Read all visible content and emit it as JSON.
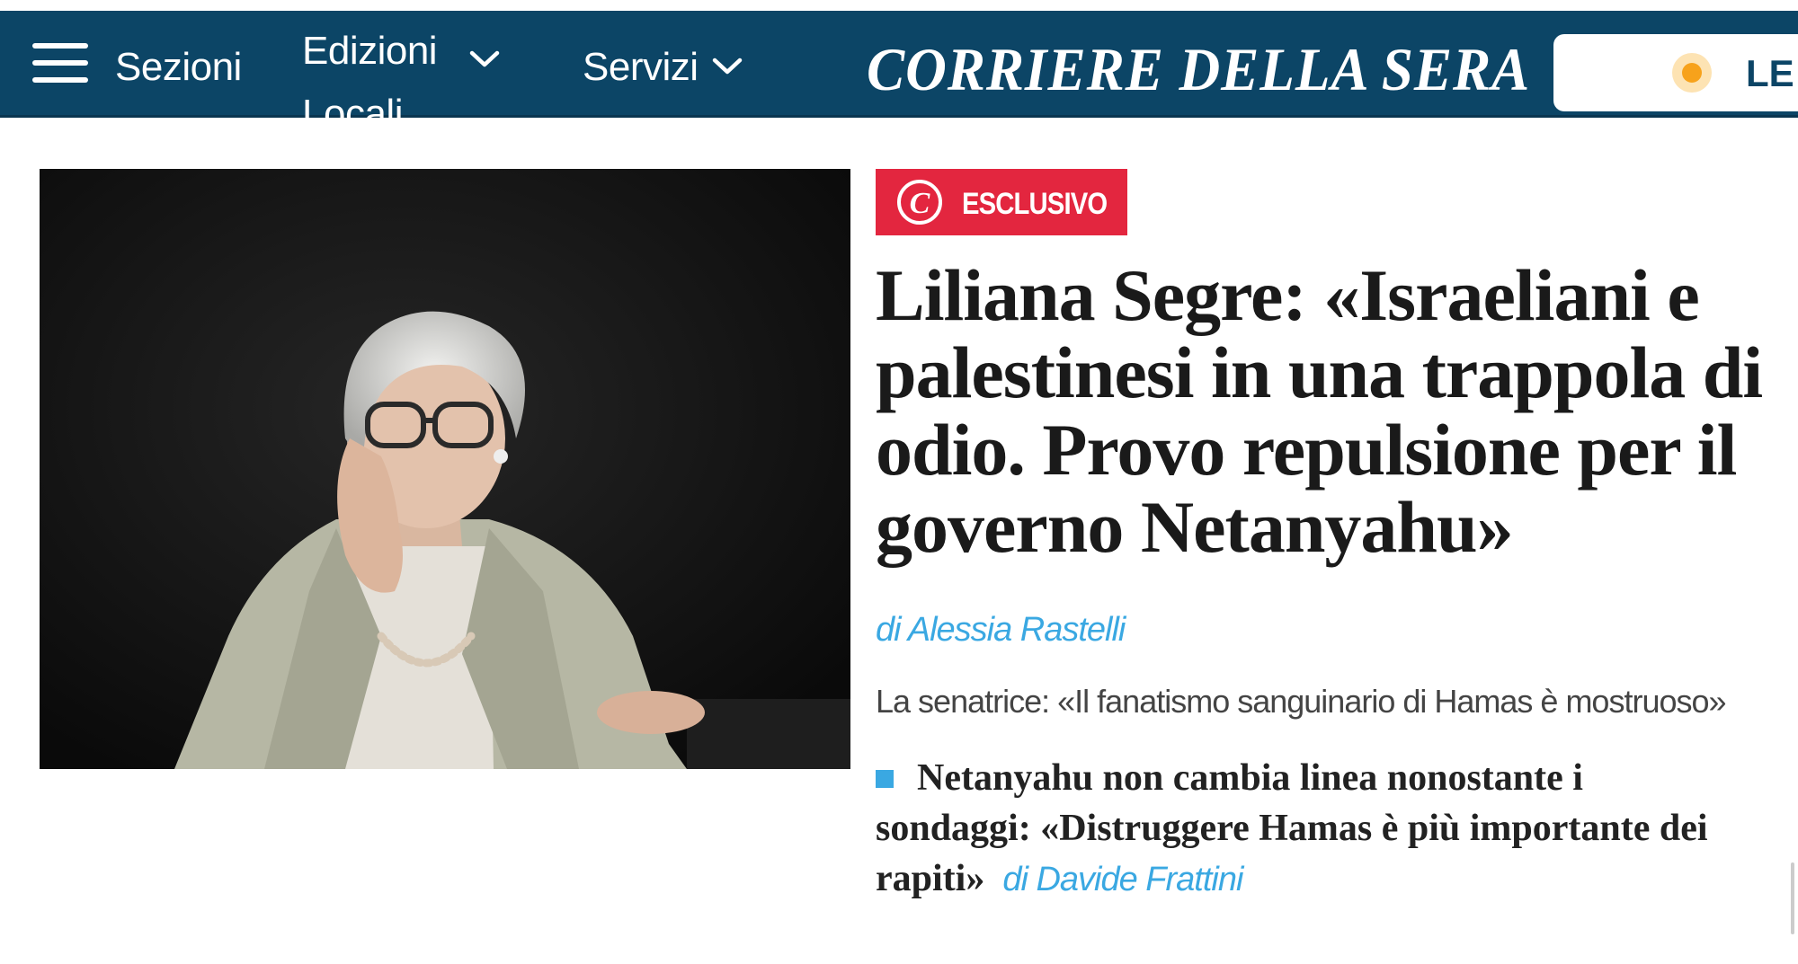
{
  "nav": {
    "sections_label": "Sezioni",
    "editions_label": "Edizioni Locali",
    "services_label": "Servizi",
    "logo_text": "CORRIERE DELLA SERA",
    "right_pill_label": "LE T",
    "brand_color": "#0c4566",
    "live_dot_color": "#f7a21b"
  },
  "article": {
    "badge_icon": "corriere-c-logo",
    "badge_label": "ESCLUSIVO",
    "badge_color": "#e3263f",
    "headline": "Liliana Segre: «Israeliani e palestinesi in una trappola di odio. Provo repulsione per il governo Netanyahu»",
    "byline": "di Alessia Rastelli",
    "subtitle": "La senatrice: «Il fanatismo sanguinario di Hamas è mostruoso»",
    "link_color": "#3aa8e2"
  },
  "related": {
    "text": "Netanyahu non cambia linea nonostante i sondaggi: «Distruggere Hamas è più importante dei rapiti»",
    "author": "di Davide Frattini"
  }
}
